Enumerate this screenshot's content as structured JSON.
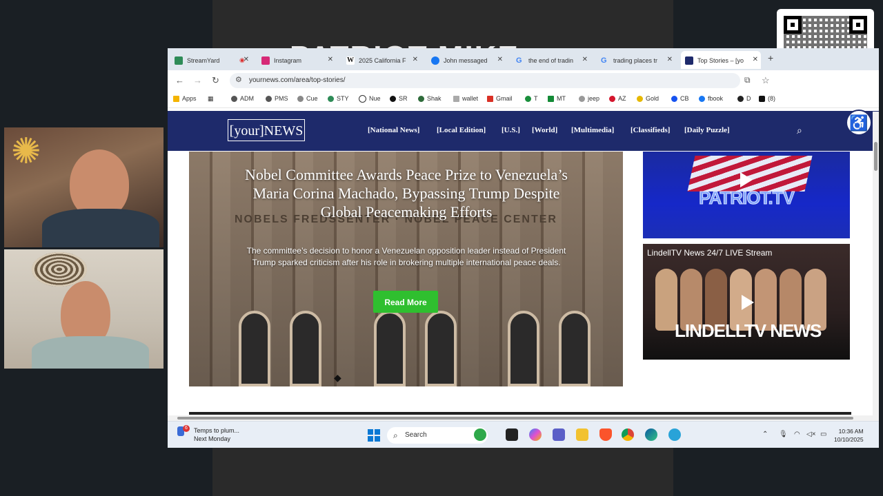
{
  "browser": {
    "tabs": [
      {
        "label": "StreamYard",
        "icon": "streamyard-icon",
        "color": "#2e8b57"
      },
      {
        "label": "Instagram",
        "icon": "instagram-icon",
        "color": "#d62976"
      },
      {
        "label": "2025 California F",
        "icon": "wikipedia-icon",
        "color": "#444444"
      },
      {
        "label": "John messaged",
        "icon": "facebook-icon",
        "color": "#1877f2"
      },
      {
        "label": "the end of tradin",
        "icon": "google-icon",
        "color": "#4285f4"
      },
      {
        "label": "trading places tr",
        "icon": "google-icon",
        "color": "#4285f4"
      },
      {
        "label": "Top Stories – [yo",
        "icon": "yournews-icon",
        "color": "#1e2a6b"
      }
    ],
    "url": "yournews.com/area/top-stories/",
    "bookmarks": [
      "Apps",
      "ADM",
      "PMS",
      "Cue",
      "STY",
      "Nue",
      "SR",
      "Shak",
      "wallet",
      "Gmail",
      "T",
      "MT",
      "jeep",
      "AZ",
      "Gold",
      "CB",
      "fbook",
      "D",
      "(8)"
    ]
  },
  "site": {
    "logo": "[your]NEWS",
    "nav": [
      "[National News]",
      "[Local Edition]",
      "[U.S.]",
      "[World]",
      "[Multimedia]",
      "[Classifieds]",
      "[Daily Puzzle]"
    ]
  },
  "hero": {
    "title": "Nobel Committee Awards Peace Prize to Venezuela’s Maria Corina Machado, Bypassing Trump Despite Global Peacemaking Efforts",
    "subtitle": "The committee’s decision to honor a Venezuelan opposition leader instead of President Trump sparked criticism after his role in brokering multiple international peace deals.",
    "button": "Read More",
    "building_sign": "NOBELS FREDSSENTER · NOBEL PEACE CENTER"
  },
  "ads": {
    "patriot": "PATRIOT.TV",
    "lindell_header": "LindellTV News 24/7 LIVE Stream",
    "lindell_logo": "LINDELLTV NEWS"
  },
  "taskbar": {
    "notification_count": "6",
    "weather_title": "Temps to plum...",
    "weather_sub": "Next Monday",
    "search": "Search",
    "time": "10:36 AM",
    "date": "10/10/2025"
  },
  "background_title": "PATRIOT MIKE"
}
